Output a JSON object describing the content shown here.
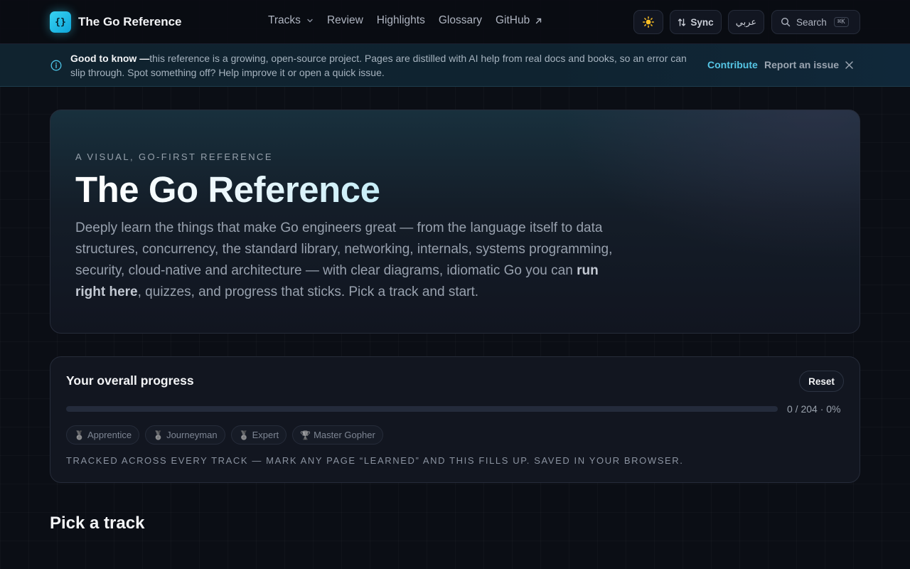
{
  "header": {
    "brand_name": "The Go Reference",
    "logo_glyph": "{}",
    "nav": [
      {
        "label": "Tracks"
      },
      {
        "label": "Review"
      },
      {
        "label": "Highlights"
      },
      {
        "label": "Glossary"
      },
      {
        "label": "GitHub"
      }
    ],
    "theme_icon": "sun-icon",
    "sync_label": "Sync",
    "lang_label": "عربي",
    "search_label": "Search",
    "search_shortcut": "⌘K"
  },
  "notice": {
    "lead": "Good to know —",
    "text": "this reference is a growing, open-source project. Pages are distilled with AI help from real docs and books, so an error can slip through. Spot something off? Help improve it or open a quick issue.",
    "contribute_label": "Contribute",
    "report_label": "Report an issue"
  },
  "hero": {
    "eyebrow": "A VISUAL, GO-FIRST REFERENCE",
    "title": "The Go Reference",
    "desc_before": "Deeply learn the things that make Go engineers great — from the language itself to data structures, concurrency, the standard library, networking, internals, systems programming, security, cloud-native and architecture — with clear diagrams, idiomatic Go you can ",
    "desc_bold": "run right here",
    "desc_after": ", quizzes, and progress that sticks. Pick a track and start."
  },
  "progress": {
    "title": "Your overall progress",
    "reset_label": "Reset",
    "learned": 0,
    "total": 204,
    "count_text": "0 / 204 · 0%",
    "fraction": 0.0,
    "badges": [
      {
        "icon": "🏅",
        "label": "Apprentice"
      },
      {
        "icon": "🏅",
        "label": "Journeyman"
      },
      {
        "icon": "🏅",
        "label": "Expert"
      },
      {
        "icon": "🏆",
        "label": "Master Gopher"
      }
    ],
    "note": "TRACKED ACROSS EVERY TRACK — MARK ANY PAGE “LEARNED” AND THIS FILLS UP. SAVED IN YOUR BROWSER."
  },
  "section": {
    "pick_title": "Pick a track"
  },
  "colors": {
    "accent": "#38d3f2",
    "background": "#0b0e15"
  }
}
